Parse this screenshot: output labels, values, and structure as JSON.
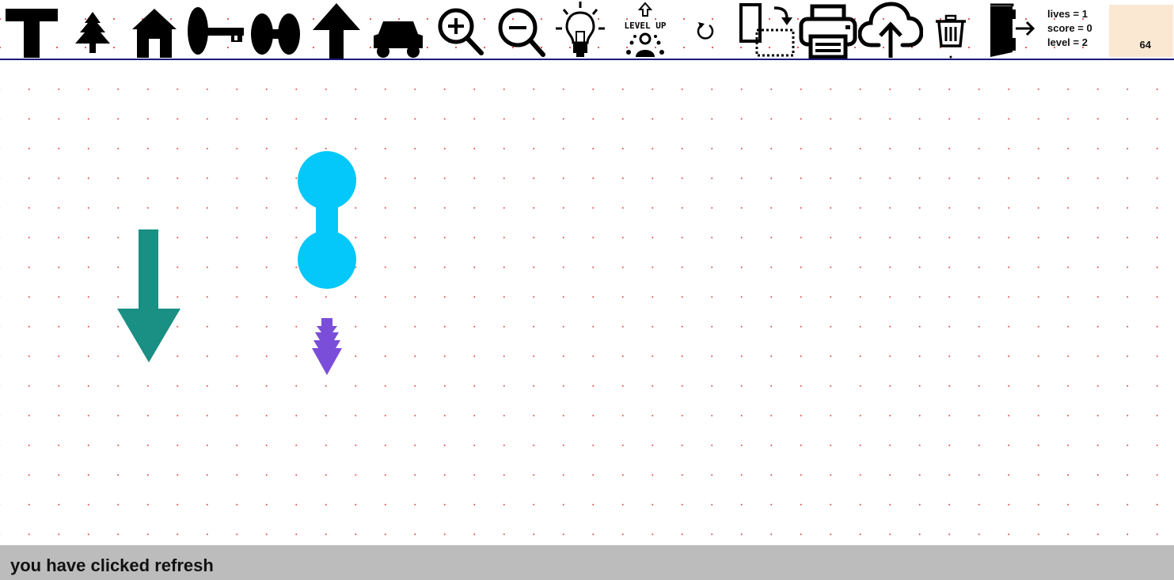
{
  "toolbar": {
    "tools": [
      {
        "name": "t-shape-tool",
        "icon": "t-block-icon"
      },
      {
        "name": "tree-tool",
        "icon": "tree-icon"
      },
      {
        "name": "house-tool",
        "icon": "house-icon"
      },
      {
        "name": "key-tool",
        "icon": "key-icon"
      },
      {
        "name": "dumbbell-tool",
        "icon": "dumbbell-icon"
      },
      {
        "name": "up-arrow-tool",
        "icon": "arrow-up-icon"
      },
      {
        "name": "car-tool",
        "icon": "car-icon"
      },
      {
        "name": "zoom-in-button",
        "icon": "zoom-in-icon"
      },
      {
        "name": "zoom-out-button",
        "icon": "zoom-out-icon"
      },
      {
        "name": "hint-button",
        "icon": "lightbulb-icon"
      },
      {
        "name": "level-up-button",
        "icon": "level-up-icon"
      },
      {
        "name": "refresh-button",
        "icon": "refresh-icon"
      },
      {
        "name": "copy-button",
        "icon": "copy-paste-icon"
      },
      {
        "name": "print-button",
        "icon": "printer-icon"
      },
      {
        "name": "upload-button",
        "icon": "cloud-upload-icon"
      },
      {
        "name": "delete-button",
        "icon": "trash-icon"
      },
      {
        "name": "exit-button",
        "icon": "exit-door-icon"
      }
    ],
    "level_up_label": "LEVEL UP"
  },
  "stats": {
    "lives": "lives = 1",
    "score": "score = 0",
    "level": "level = 2"
  },
  "counter": "64",
  "status": "you have clicked refresh",
  "colors": {
    "teal_arrow": "#1a8f83",
    "cyan_dumbbell": "#05c8fa",
    "purple_tree": "#7b4ed9",
    "grid_dot": "#e05050",
    "status_bar": "#bcbcbc",
    "counter_bg": "#fbe8d3",
    "toolbar_border": "#1a1a7a"
  },
  "pieces": [
    {
      "kind": "arrow-down",
      "color": "teal"
    },
    {
      "kind": "dumbbell",
      "color": "cyan"
    },
    {
      "kind": "tree-pointing-down",
      "color": "purple"
    }
  ]
}
